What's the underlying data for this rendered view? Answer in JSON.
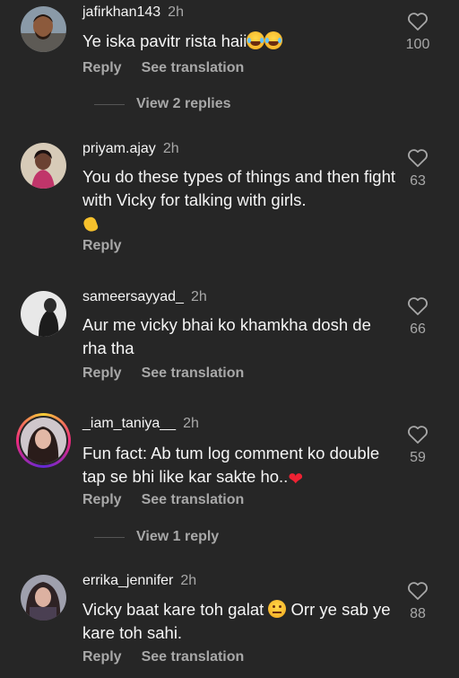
{
  "comments": [
    {
      "username": "jafirkhan143",
      "time": "2h",
      "text": "Ye iska pavitr rista haii",
      "emoji": [
        "face-with-tears-of-joy",
        "face-with-tears-of-joy"
      ],
      "reply_label": "Reply",
      "translate_label": "See translation",
      "likes": "100",
      "view_replies": "View 2 replies",
      "avatar_color": "#7a6a5a"
    },
    {
      "username": "priyam.ajay",
      "time": "2h",
      "text": "You do these types of things and then fight with Vicky for talking with girls.",
      "emoji": [
        "clapping-hands"
      ],
      "reply_label": "Reply",
      "likes": "63",
      "avatar_color": "#c9b59a"
    },
    {
      "username": "sameersayyad_",
      "time": "2h",
      "text": "Aur me vicky bhai ko khamkha dosh de rha tha",
      "reply_label": "Reply",
      "translate_label": "See translation",
      "likes": "66",
      "avatar_color": "#4b4b4b"
    },
    {
      "username": "_iam_taniya__",
      "time": "2h",
      "text": "Fun fact: Ab tum log comment ko double tap se bhi like kar sakte ho..",
      "emoji": [
        "red-heart"
      ],
      "reply_label": "Reply",
      "translate_label": "See translation",
      "likes": "59",
      "view_replies": "View 1 reply",
      "avatar_color": "#b7b2b8"
    },
    {
      "username": "errika_jennifer",
      "time": "2h",
      "text_part1": "Vicky baat kare toh galat",
      "text_part2": "Orr ye sab ye kare toh sahi.",
      "emoji": [
        "face-with-raised-eyebrow"
      ],
      "reply_label": "Reply",
      "translate_label": "See translation",
      "likes": "88",
      "avatar_color": "#6b6b78"
    }
  ],
  "colors": {
    "background": "#262626",
    "primary_text": "#f5f5f5",
    "secondary_text": "#a8a8a8"
  }
}
